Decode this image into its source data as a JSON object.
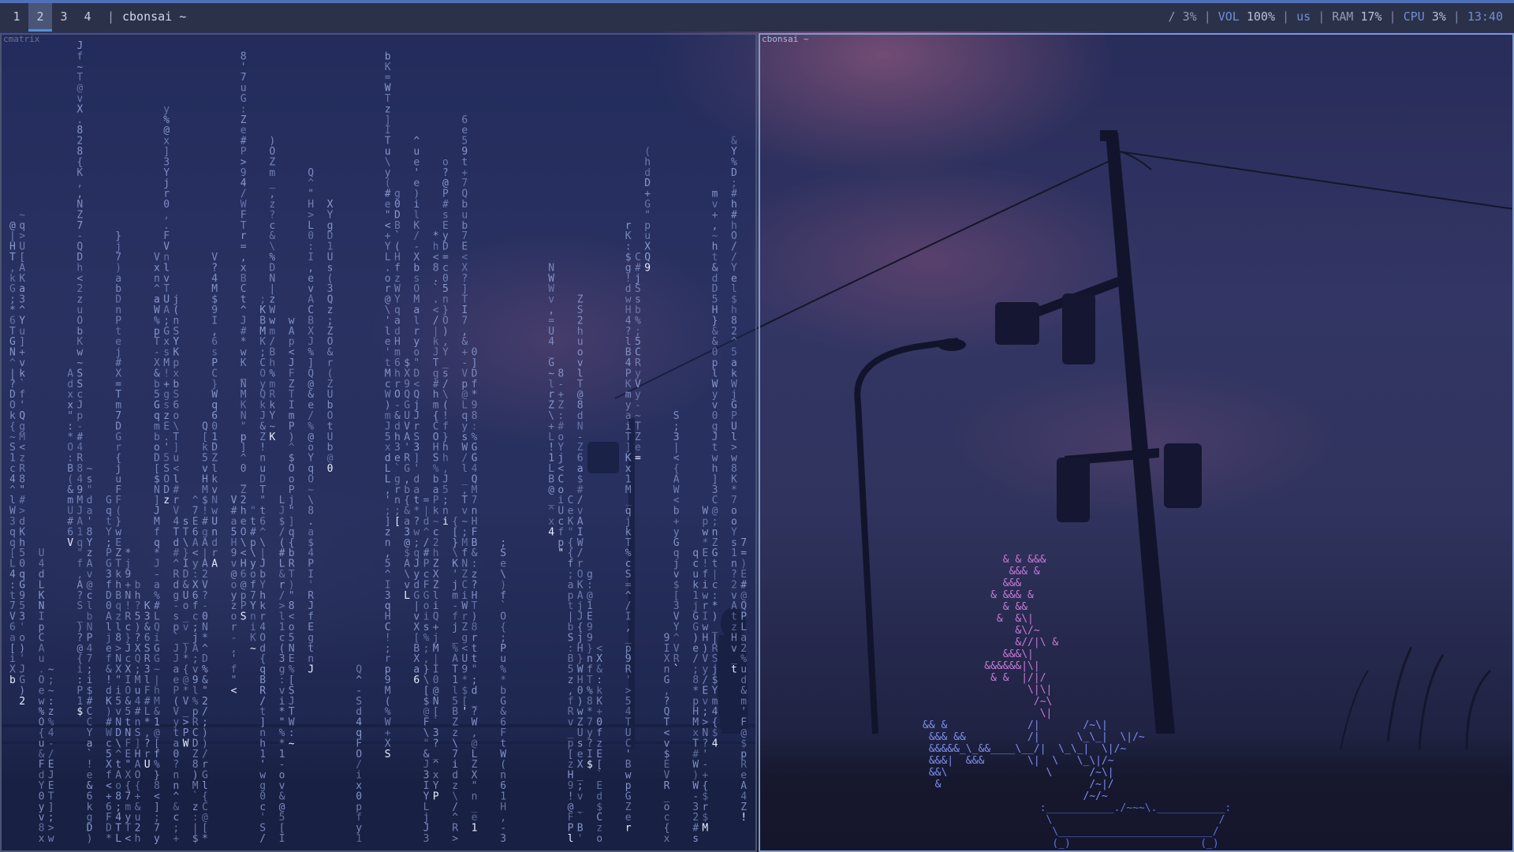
{
  "workspaces": [
    {
      "label": "1",
      "active": false
    },
    {
      "label": "2",
      "active": true
    },
    {
      "label": "3",
      "active": false
    },
    {
      "label": "4",
      "active": false
    }
  ],
  "bar": {
    "separator": "|",
    "window_title": "cbonsai ~"
  },
  "status": {
    "disk": "/ 3%",
    "volume_label": "VOL",
    "volume_value": "100%",
    "keyboard_layout": "us",
    "ram_label": "RAM",
    "ram_value": "17%",
    "cpu_label": "CPU",
    "cpu_value": "3%",
    "time": "13:40"
  },
  "windows": {
    "left": {
      "title": "cmatrix"
    },
    "right": {
      "title": "cbonsai ~"
    }
  },
  "colors": {
    "bar_bg": "#2b3148",
    "bar_accent": "#4f6fb8",
    "status_accent": "#6f8fd8",
    "matrix_text": "#9fb0e0",
    "bonsai_leaf": "#c97ad8",
    "bonsai_trunk": "#7d8ff0",
    "bonsai_pot": "#5f73e0"
  },
  "bonsai": {
    "leaves": [
      "             & & &&&",
      "              &&& &",
      "             &&&",
      "           & &&& &",
      "             & &&",
      "            &  &\\|",
      "               &\\/~",
      "               &//|\\ &",
      "             &&&\\|",
      "          &&&&&&|\\|",
      "           & &  |/|/",
      "                 \\|\\|",
      "                  /~\\",
      "                   \\|"
    ],
    "trunk": [
      "&& &             /|       /~\\|",
      " &&& &&          /|      \\_\\_|  \\|/~",
      " &&&&&_\\_&&____\\__/|  \\_\\_|  \\|/~",
      " &&&|  &&&       \\|  \\   \\_\\|/~",
      " &&\\                \\      /~\\|",
      "  &                        /~|/",
      "                          /~/~"
    ],
    "pot": [
      "                   :___________./~~~\\.___________:",
      "                    \\                           /",
      "                     \\_________________________/",
      "                     (_)                     (_)"
    ]
  }
}
